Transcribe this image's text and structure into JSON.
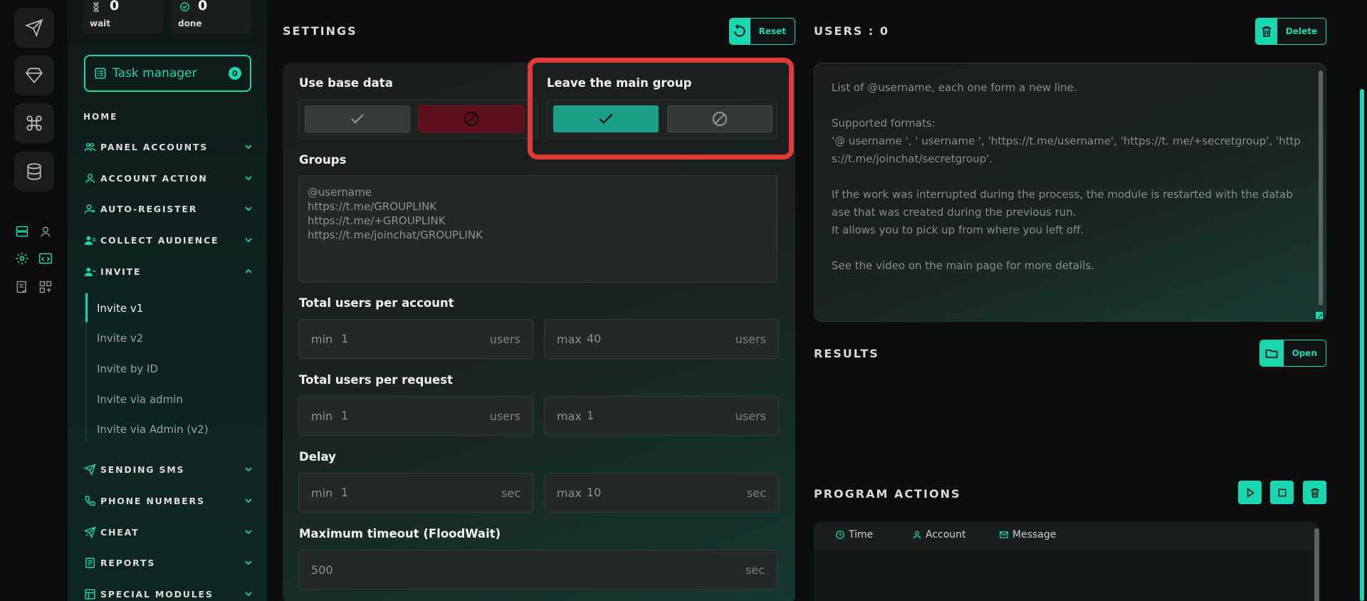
{
  "stats": {
    "wait": {
      "value": "0",
      "label": "wait"
    },
    "done": {
      "value": "0",
      "label": "done"
    }
  },
  "task_manager": {
    "label": "Task manager",
    "badge": "0"
  },
  "nav": {
    "home": "HOME",
    "items": [
      {
        "label": "PANEL ACCOUNTS",
        "icon": "users-icon"
      },
      {
        "label": "ACCOUNT ACTION",
        "icon": "user-icon"
      },
      {
        "label": "AUTO-REGISTER",
        "icon": "user-plus-icon"
      },
      {
        "label": "COLLECT AUDIENCE",
        "icon": "user-list-icon"
      },
      {
        "label": "INVITE",
        "icon": "user-invite-icon"
      },
      {
        "label": "SENDING SMS",
        "icon": "send-icon"
      },
      {
        "label": "PHONE NUMBERS",
        "icon": "phone-icon"
      },
      {
        "label": "CHEAT",
        "icon": "cheat-icon"
      },
      {
        "label": "REPORTS",
        "icon": "report-icon"
      },
      {
        "label": "SPECIAL MODULES",
        "icon": "module-icon"
      }
    ],
    "invite_sub": [
      "Invite v1",
      "Invite v2",
      "Invite by ID",
      "Invite via admin",
      "Invite via Admin (v2)"
    ]
  },
  "settings": {
    "title": "SETTINGS",
    "reset_label": "Reset",
    "use_base_data": "Use base data",
    "leave_main_group": "Leave the main group",
    "groups_label": "Groups",
    "groups_placeholder": "@username\nhttps://t.me/GROUPLINK\nhttps://t.me/+GROUPLINK\nhttps://t.me/joinchat/GROUPLINK",
    "total_per_account": {
      "label": "Total users per account",
      "min_pre": "min",
      "min": "1",
      "max_pre": "max",
      "max": "40",
      "unit": "users"
    },
    "total_per_request": {
      "label": "Total users per request",
      "min_pre": "min",
      "min": "1",
      "max_pre": "max",
      "max": "1",
      "unit": "users"
    },
    "delay": {
      "label": "Delay",
      "min_pre": "min",
      "min": "1",
      "max_pre": "max",
      "max": "10",
      "unit": "sec"
    },
    "timeout": {
      "label": "Maximum timeout (FloodWait)",
      "value": "500",
      "unit": "sec"
    }
  },
  "users": {
    "title": "USERS : 0",
    "delete_label": "Delete",
    "placeholder": [
      "List of @username, each one form a new line.",
      "",
      "Supported formats:",
      "'@ username ', ' username ', 'https://t.me/username', 'https://t. me/+secretgroup', 'http s://t.me/joinchat/secretgroup'.",
      "",
      "If the work was interrupted during the process, the module is restarted with the datab ase that was created during the previous run.",
      "It allows you to pick up from where you left off.",
      "",
      "See the video on the main page for more details."
    ]
  },
  "results": {
    "title": "RESULTS",
    "open_label": "Open"
  },
  "program_actions": {
    "title": "PROGRAM ACTIONS",
    "columns": [
      "Time",
      "Account",
      "Message"
    ]
  },
  "colors": {
    "accent": "#19d7b0",
    "danger": "#e03a3a",
    "off_red": "#5e0f19"
  }
}
